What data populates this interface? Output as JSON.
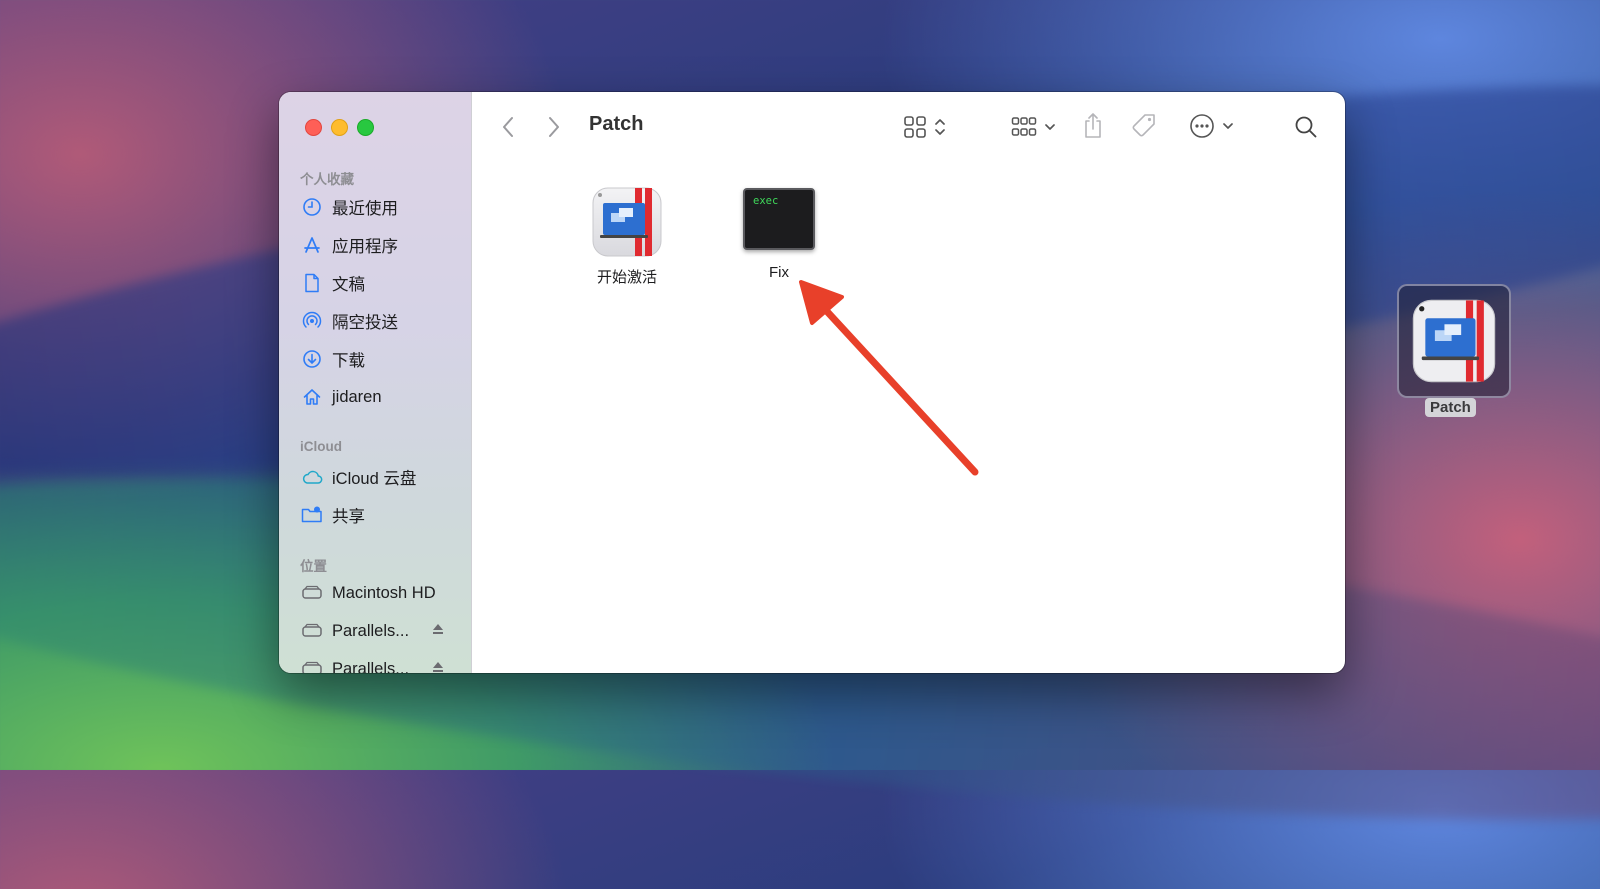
{
  "window": {
    "title": "Patch",
    "sidebar": {
      "favorites_title": "个人收藏",
      "favorites": [
        {
          "label": "最近使用",
          "icon": "clock-icon"
        },
        {
          "label": "应用程序",
          "icon": "applications-icon"
        },
        {
          "label": "文稿",
          "icon": "document-icon"
        },
        {
          "label": "隔空投送",
          "icon": "airdrop-icon"
        },
        {
          "label": "下载",
          "icon": "download-icon"
        },
        {
          "label": "jidaren",
          "icon": "home-icon"
        }
      ],
      "icloud_title": "iCloud",
      "icloud": [
        {
          "label": "iCloud 云盘",
          "icon": "cloud-icon"
        },
        {
          "label": "共享",
          "icon": "shared-folder-icon"
        }
      ],
      "locations_title": "位置",
      "locations": [
        {
          "label": "Macintosh HD",
          "icon": "drive-icon"
        },
        {
          "label": "Parallels...",
          "icon": "drive-icon",
          "eject": true
        },
        {
          "label": "Parallels...",
          "icon": "drive-icon",
          "eject": true
        }
      ]
    },
    "files": [
      {
        "name": "开始激活",
        "icon": "parallels-app-icon"
      },
      {
        "name": "Fix",
        "icon": "terminal-exec-icon",
        "icon_text": "exec"
      }
    ]
  },
  "desktop": {
    "icon_label": "Patch",
    "icon": "parallels-app-icon"
  },
  "colors": {
    "arrow": "#e8402a",
    "accent": "#2f7cf6"
  }
}
